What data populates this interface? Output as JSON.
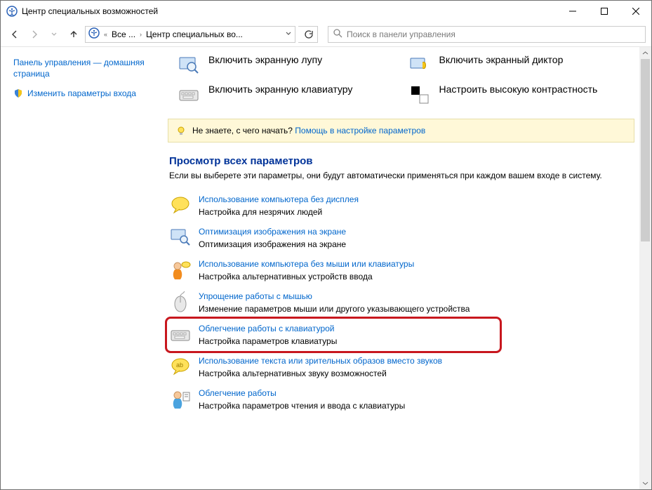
{
  "window": {
    "title": "Центр специальных возможностей"
  },
  "addressbar": {
    "crumb1": "Все ...",
    "crumb2": "Центр специальных во..."
  },
  "search": {
    "placeholder": "Поиск в панели управления"
  },
  "sidebar": {
    "home": "Панель управления — домашняя страница",
    "change_signin": "Изменить параметры входа"
  },
  "quick": {
    "magnifier": "Включить экранную лупу",
    "narrator": "Включить экранный диктор",
    "onscreen_kb": "Включить экранную клавиатуру",
    "high_contrast": "Настроить высокую контрастность"
  },
  "hint": {
    "prefix": "Не знаете, с чего начать? ",
    "link": "Помощь в настройке параметров"
  },
  "section": {
    "title": "Просмотр всех параметров",
    "desc": "Если вы выберете эти параметры, они будут автоматически применяться при каждом вашем входе в систему."
  },
  "settings": [
    {
      "title": "Использование компьютера без дисплея",
      "sub": "Настройка для незрячих людей"
    },
    {
      "title": "Оптимизация изображения на экране",
      "sub": "Оптимизация изображения на экране"
    },
    {
      "title": "Использование компьютера без мыши или клавиатуры",
      "sub": "Настройка альтернативных устройств ввода"
    },
    {
      "title": "Упрощение работы с мышью",
      "sub": "Изменение параметров мыши или другого указывающего устройства"
    },
    {
      "title": "Облегчение работы с клавиатурой",
      "sub": "Настройка параметров клавиатуры"
    },
    {
      "title": "Использование текста или зрительных образов вместо звуков",
      "sub": "Настройка альтернативных звуку возможностей"
    },
    {
      "title": "Облегчение работы",
      "sub": "Настройка параметров чтения и ввода с клавиатуры"
    }
  ]
}
